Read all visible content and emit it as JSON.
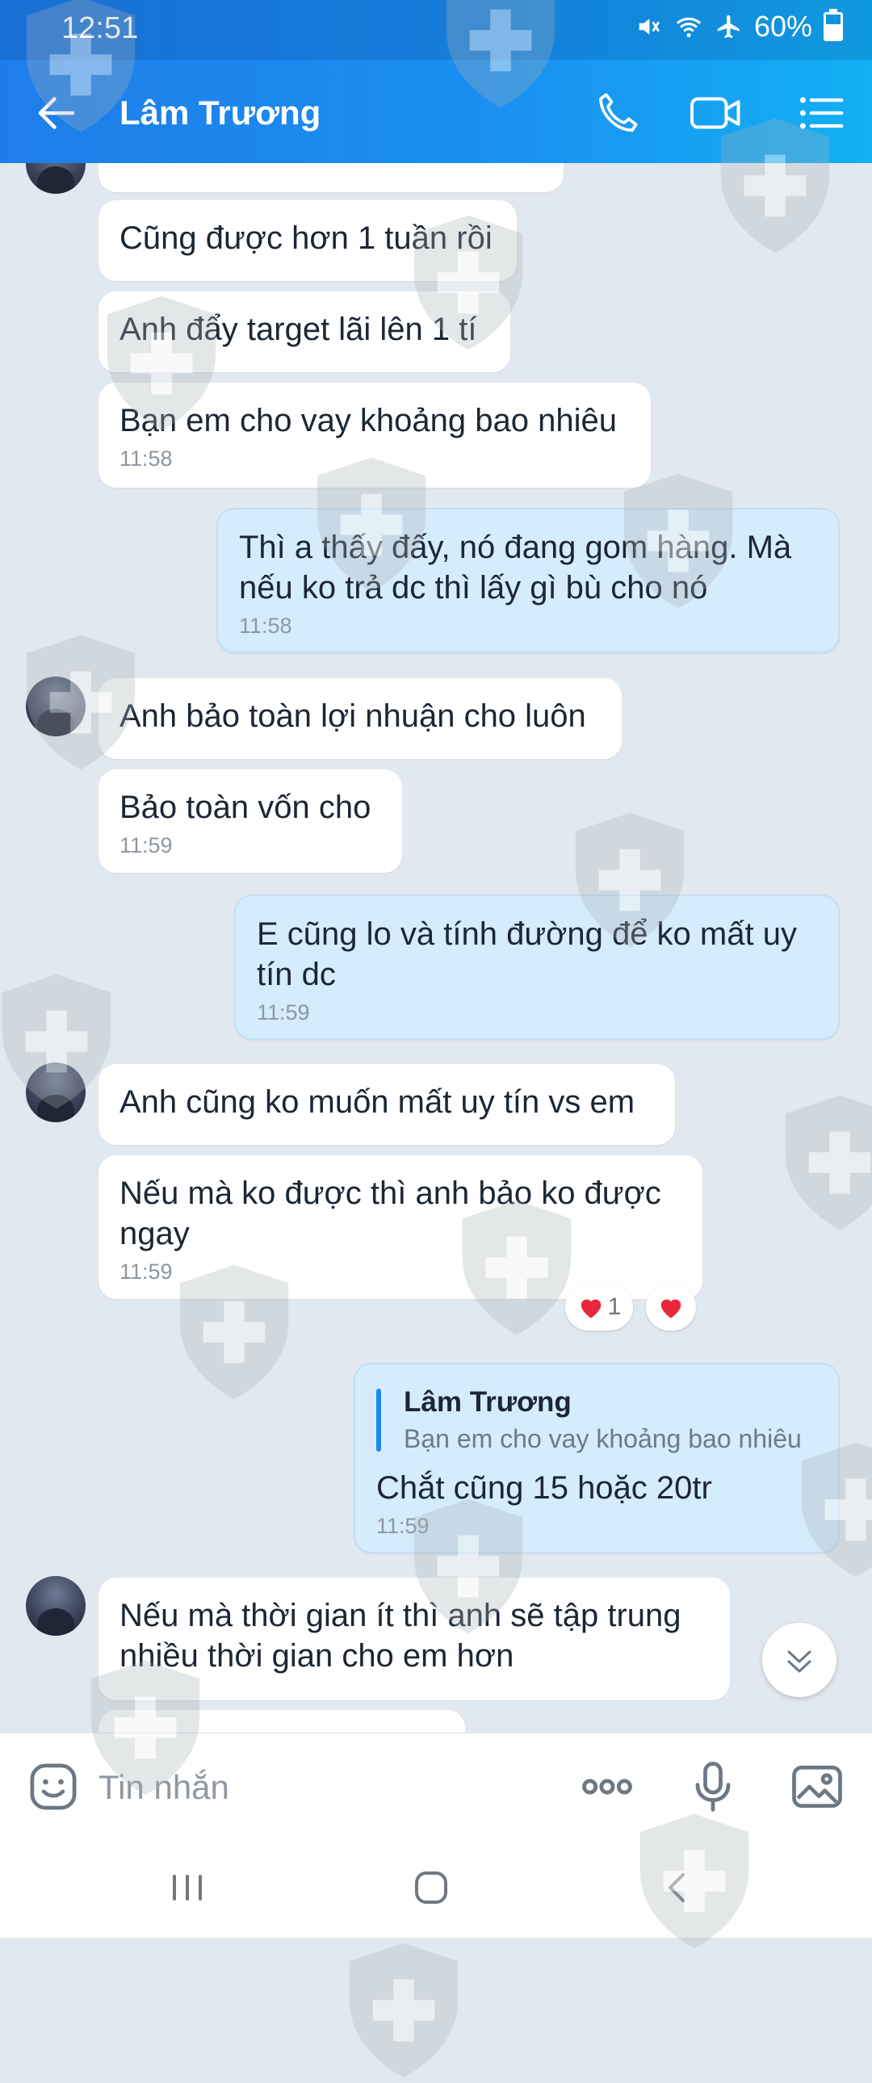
{
  "status_bar": {
    "time": "12:51",
    "battery": "60%",
    "battery_level": 0.6
  },
  "header": {
    "title": "Lâm Trương"
  },
  "messages": [
    {
      "text": "Cũng được hơn 1 tuần rồi"
    },
    {
      "text": "Anh đẩy target lãi lên 1 tí"
    },
    {
      "text": "Bạn em cho vay khoảng bao nhiêu",
      "time": "11:58"
    },
    {
      "text": "Thì a thấy đấy, nó đang gom hàng. Mà nếu ko trả dc thì lấy gì bù cho nó",
      "time": "11:58"
    },
    {
      "text": "Anh bảo toàn lợi nhuận cho luôn"
    },
    {
      "text": "Bảo toàn vốn cho",
      "time": "11:59"
    },
    {
      "text": "E cũng lo và tính đường để ko mất uy tín dc",
      "time": "11:59"
    },
    {
      "text": "Anh cũng ko muốn mất uy tín vs em"
    },
    {
      "text": "Nếu mà ko được thì anh bảo ko được ngay",
      "time": "11:59",
      "reaction_count": "1"
    },
    {
      "quote_name": "Lâm Trương",
      "quote_text": "Bạn em cho vay khoảng bao nhiêu",
      "text": "Chắt cũng 15 hoặc 20tr",
      "time": "11:59"
    },
    {
      "text": "Nếu mà thời gian ít thì anh sẽ tập trung nhiều thời gian cho em hơn"
    }
  ],
  "composer": {
    "placeholder": "Tin nhắn"
  },
  "colors": {
    "header_start": "#1f7de9",
    "header_end": "#12b0f5",
    "own_bubble": "#d5ecfc",
    "chat_background": "#e2e8ef",
    "reaction_heart": "#e8283a"
  },
  "icons": [
    "back-arrow-icon",
    "phone-icon",
    "video-call-icon",
    "menu-list-icon",
    "emoji-icon",
    "more-dots-icon",
    "microphone-icon",
    "image-icon",
    "chevron-down-icon",
    "heart-icon"
  ]
}
